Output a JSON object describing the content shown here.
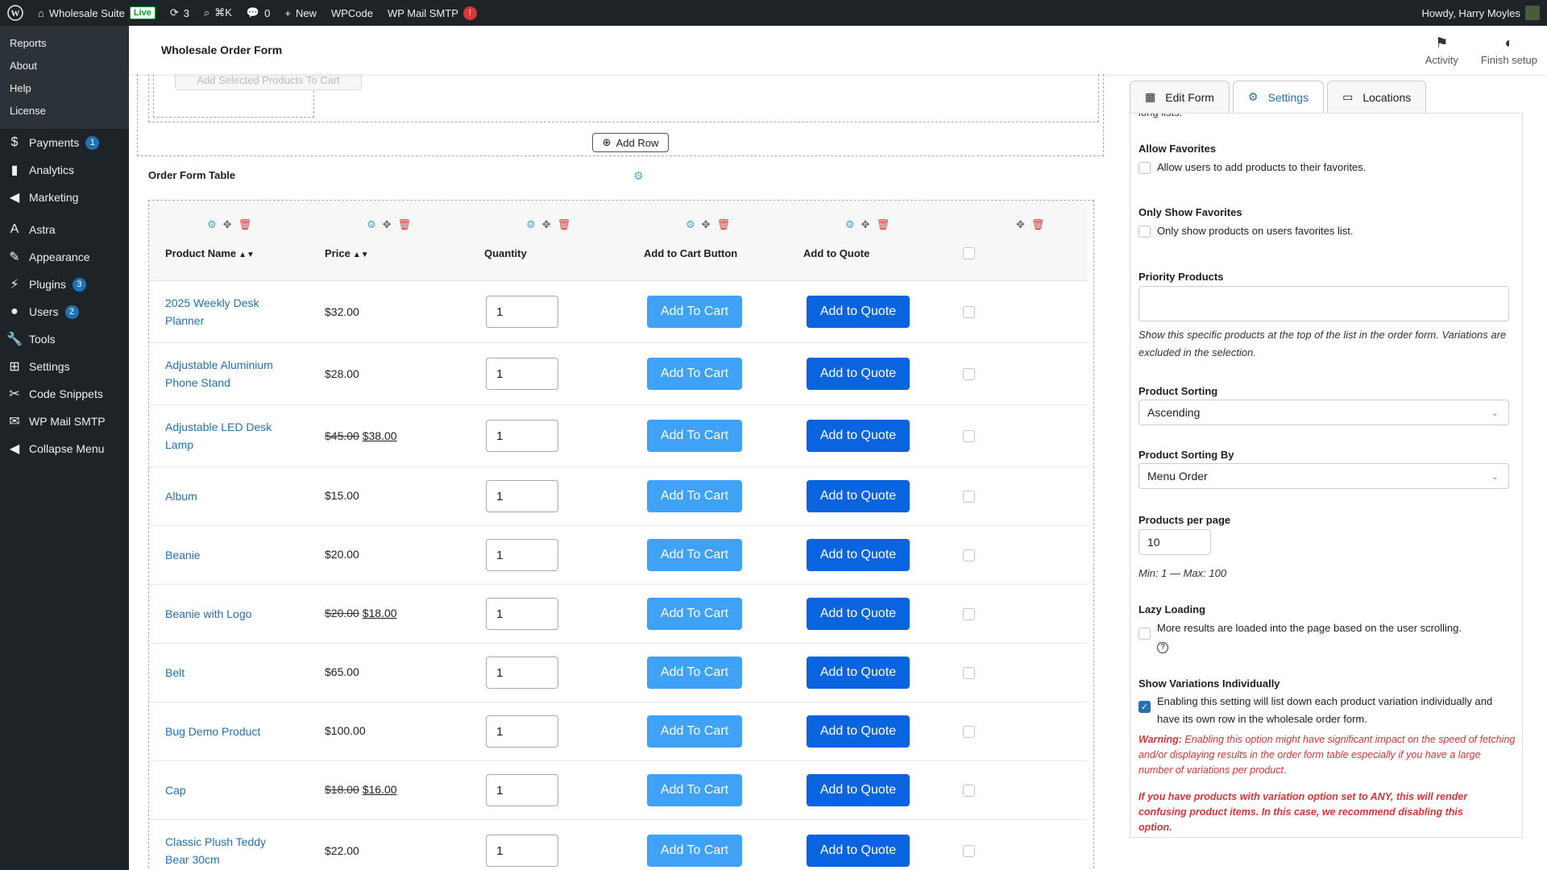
{
  "adminbar": {
    "site_name": "Wholesale Suite",
    "live_label": "Live",
    "updates_count": "3",
    "search_shortcut": "⌘K",
    "comments_count": "0",
    "new_label": "New",
    "wpcode_label": "WPCode",
    "smtp_label": "WP Mail SMTP",
    "smtp_alert": "!",
    "greeting": "Howdy, Harry Moyles"
  },
  "sidebar": {
    "submenu": [
      "Reports",
      "About",
      "Help",
      "License"
    ],
    "items": [
      {
        "label": "Payments",
        "icon": "$",
        "count": "1"
      },
      {
        "label": "Analytics",
        "icon": "▮",
        "count": ""
      },
      {
        "label": "Marketing",
        "icon": "◀",
        "count": ""
      },
      {
        "label": "Astra",
        "icon": "A",
        "count": ""
      },
      {
        "label": "Appearance",
        "icon": "✎",
        "count": ""
      },
      {
        "label": "Plugins",
        "icon": "⚡",
        "count": "3"
      },
      {
        "label": "Users",
        "icon": "●",
        "count": "2"
      },
      {
        "label": "Tools",
        "icon": "🔧",
        "count": ""
      },
      {
        "label": "Settings",
        "icon": "⊞",
        "count": ""
      },
      {
        "label": "Code Snippets",
        "icon": "✂",
        "count": ""
      },
      {
        "label": "WP Mail SMTP",
        "icon": "✉",
        "count": ""
      },
      {
        "label": "Collapse Menu",
        "icon": "◀",
        "count": ""
      }
    ]
  },
  "header": {
    "title": "Wholesale Order Form",
    "activity_label": "Activity",
    "finish_label": "Finish setup"
  },
  "editor": {
    "add_selected_label": "Add Selected Products To Cart",
    "add_row_label": "Add Row",
    "section_title": "Order Form Table",
    "columns": [
      "Product Name",
      "Price",
      "Quantity",
      "Add to Cart Button",
      "Add to Quote"
    ],
    "rows": [
      {
        "name": "2025 Weekly Desk Planner",
        "old_price": "",
        "price": "$32.00",
        "qty": "1"
      },
      {
        "name": "Adjustable Aluminium Phone Stand",
        "old_price": "",
        "price": "$28.00",
        "qty": "1"
      },
      {
        "name": "Adjustable LED Desk Lamp",
        "old_price": "$45.00",
        "price": "$38.00",
        "qty": "1"
      },
      {
        "name": "Album",
        "old_price": "",
        "price": "$15.00",
        "qty": "1"
      },
      {
        "name": "Beanie",
        "old_price": "",
        "price": "$20.00",
        "qty": "1"
      },
      {
        "name": "Beanie with Logo",
        "old_price": "$20.00",
        "price": "$18.00",
        "qty": "1"
      },
      {
        "name": "Belt",
        "old_price": "",
        "price": "$65.00",
        "qty": "1"
      },
      {
        "name": "Bug Demo Product",
        "old_price": "",
        "price": "$100.00",
        "qty": "1"
      },
      {
        "name": "Cap",
        "old_price": "$18.00",
        "price": "$16.00",
        "qty": "1"
      },
      {
        "name": "Classic Plush Teddy Bear 30cm",
        "old_price": "",
        "price": "$22.00",
        "qty": "1"
      }
    ],
    "add_to_cart_label": "Add To Cart",
    "add_to_quote_label": "Add to Quote"
  },
  "panel": {
    "tabs": [
      "Edit Form",
      "Settings",
      "Locations"
    ],
    "cut_text": "long lists.",
    "allow_fav_title": "Allow Favorites",
    "allow_fav_text": "Allow users to add products to their favorites.",
    "only_fav_title": "Only Show Favorites",
    "only_fav_text": "Only show products on users favorites list.",
    "priority_title": "Priority Products",
    "priority_help": "Show this specific products at the top of the list in the order form. Variations are excluded in the selection.",
    "sorting_title": "Product Sorting",
    "sorting_value": "Ascending",
    "sorting_by_title": "Product Sorting By",
    "sorting_by_value": "Menu Order",
    "per_page_title": "Products per page",
    "per_page_value": "10",
    "per_page_help": "Min: 1 — Max: 100",
    "lazy_title": "Lazy Loading",
    "lazy_text": "More results are loaded into the page based on the user scrolling.",
    "variations_title": "Show Variations Individually",
    "variations_text": "Enabling this setting will list down each product variation individually and have its own row in the wholesale order form.",
    "warning_label": "Warning:",
    "warning_text": "Enabling this option might have significant impact on the speed of fetching and/or displaying results in the order form table especially if you have a large number of variations per product.",
    "any_warning": "If you have products with variation option set to ANY, this will render confusing product items. In this case, we recommend disabling this option."
  }
}
